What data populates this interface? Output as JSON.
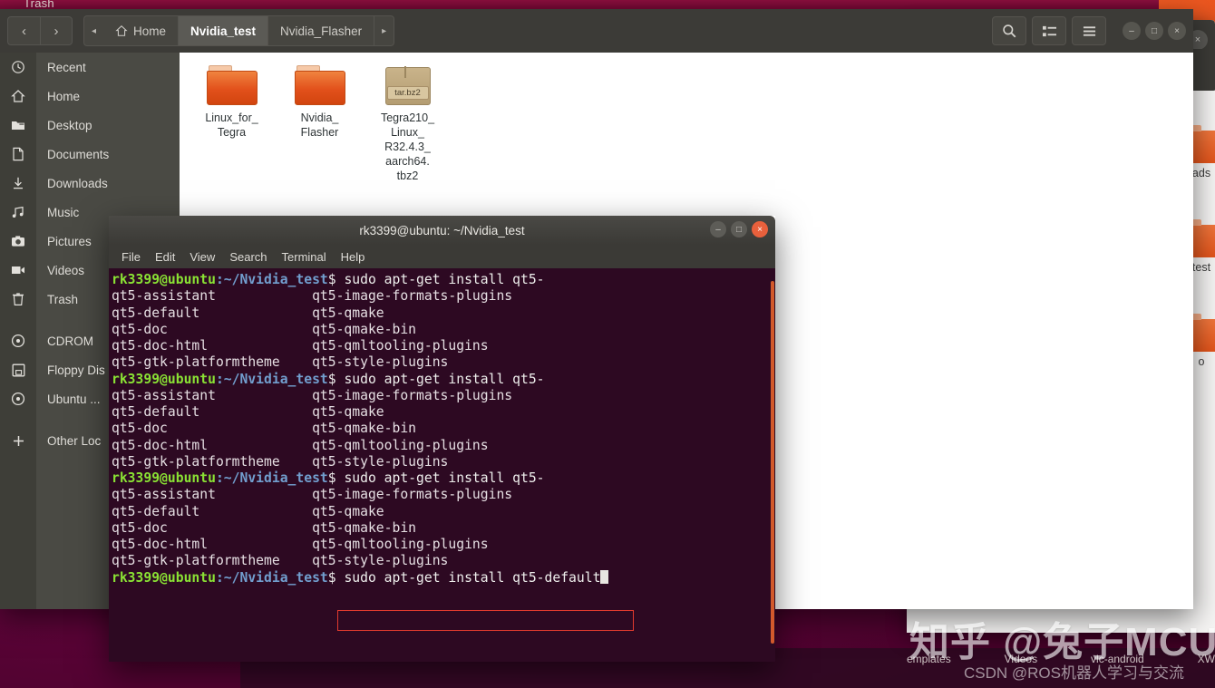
{
  "desktop": {
    "trash_label": "Trash",
    "background_labels": [
      "emplates",
      "Videos",
      "vlc-android",
      "XW"
    ],
    "bg_colors": {
      "desktop": "#5c0438",
      "accent_orange": "#e2501b"
    }
  },
  "watermarks": {
    "zhihu": "知乎 @兔子MCU",
    "csdn": "CSDN @ROS机器人学习与交流"
  },
  "file_manager": {
    "nav": {
      "back": "‹",
      "forward": "›"
    },
    "breadcrumb": {
      "left_arrow": "◂",
      "right_arrow": "▸",
      "items": [
        {
          "label": "Home",
          "icon": "home-icon",
          "active": false
        },
        {
          "label": "Nvidia_test",
          "icon": "",
          "active": true
        },
        {
          "label": "Nvidia_Flasher",
          "icon": "",
          "active": false
        }
      ]
    },
    "toolbar": {
      "search": "search-icon",
      "view_list": "list-view-icon",
      "menu": "hamburger-menu-icon"
    },
    "window_controls": {
      "minimize": "–",
      "maximize": "□",
      "close": "×"
    },
    "sidebar": {
      "items": [
        {
          "label": "Recent",
          "icon": "clock-icon"
        },
        {
          "label": "Home",
          "icon": "home-icon"
        },
        {
          "label": "Desktop",
          "icon": "desktop-folder-icon"
        },
        {
          "label": "Documents",
          "icon": "document-icon"
        },
        {
          "label": "Downloads",
          "icon": "download-icon"
        },
        {
          "label": "Music",
          "icon": "music-note-icon"
        },
        {
          "label": "Pictures",
          "icon": "camera-icon"
        },
        {
          "label": "Videos",
          "icon": "video-icon"
        },
        {
          "label": "Trash",
          "icon": "trash-icon"
        }
      ],
      "devices": [
        {
          "label": "CDROM",
          "icon": "disc-icon"
        },
        {
          "label": "Floppy Dis",
          "icon": "floppy-icon"
        },
        {
          "label": "Ubuntu ...",
          "icon": "disc-icon"
        }
      ],
      "other": {
        "label": "Other Loc",
        "icon": "plus-icon"
      }
    },
    "files": [
      {
        "name": "Linux_for_\nTegra",
        "type": "folder"
      },
      {
        "name": "Nvidia_\nFlasher",
        "type": "folder"
      },
      {
        "name": "Tegra210_\nLinux_\nR32.4.3_\naarch64.\ntbz2",
        "type": "archive",
        "badge": "tar.bz2"
      }
    ]
  },
  "background_window": {
    "controls": {
      "maximize": "□",
      "close": "×"
    },
    "items": [
      {
        "label": "ads",
        "icon": "downloads-folder-icon"
      },
      {
        "label": "test",
        "icon": "folder-icon"
      },
      {
        "label": "o",
        "icon": "folder-icon"
      }
    ],
    "search_icon": "search-icon"
  },
  "terminal": {
    "title": "rk3399@ubuntu: ~/Nvidia_test",
    "controls": {
      "minimize": "–",
      "maximize": "□",
      "close": "×"
    },
    "menu": [
      "File",
      "Edit",
      "View",
      "Search",
      "Terminal",
      "Help"
    ],
    "prompt": {
      "user": "rk3399@ubuntu",
      "path": ":~/Nvidia_test",
      "sigil": "$"
    },
    "lines": [
      {
        "type": "prompt",
        "command": " sudo apt-get install qt5-"
      },
      {
        "type": "out",
        "text": "qt5-assistant            qt5-image-formats-plugins"
      },
      {
        "type": "out",
        "text": "qt5-default              qt5-qmake"
      },
      {
        "type": "out",
        "text": "qt5-doc                  qt5-qmake-bin"
      },
      {
        "type": "out",
        "text": "qt5-doc-html             qt5-qmltooling-plugins"
      },
      {
        "type": "out",
        "text": "qt5-gtk-platformtheme    qt5-style-plugins"
      },
      {
        "type": "prompt",
        "command": " sudo apt-get install qt5-"
      },
      {
        "type": "out",
        "text": "qt5-assistant            qt5-image-formats-plugins"
      },
      {
        "type": "out",
        "text": "qt5-default              qt5-qmake"
      },
      {
        "type": "out",
        "text": "qt5-doc                  qt5-qmake-bin"
      },
      {
        "type": "out",
        "text": "qt5-doc-html             qt5-qmltooling-plugins"
      },
      {
        "type": "out",
        "text": "qt5-gtk-platformtheme    qt5-style-plugins"
      },
      {
        "type": "prompt",
        "command": " sudo apt-get install qt5-"
      },
      {
        "type": "out",
        "text": "qt5-assistant            qt5-image-formats-plugins"
      },
      {
        "type": "out",
        "text": "qt5-default              qt5-qmake"
      },
      {
        "type": "out",
        "text": "qt5-doc                  qt5-qmake-bin"
      },
      {
        "type": "out",
        "text": "qt5-doc-html             qt5-qmltooling-plugins"
      },
      {
        "type": "out",
        "text": "qt5-gtk-platformtheme    qt5-style-plugins"
      },
      {
        "type": "prompt-cursor",
        "command": " sudo apt-get install qt5-default"
      }
    ],
    "colors": {
      "background": "#2d0922",
      "prompt_user": "#8ae234",
      "prompt_path": "#729fcf",
      "text": "#eeeeec",
      "highlight_box": "#e03a2e",
      "scrollbar": "#d2592c"
    }
  }
}
